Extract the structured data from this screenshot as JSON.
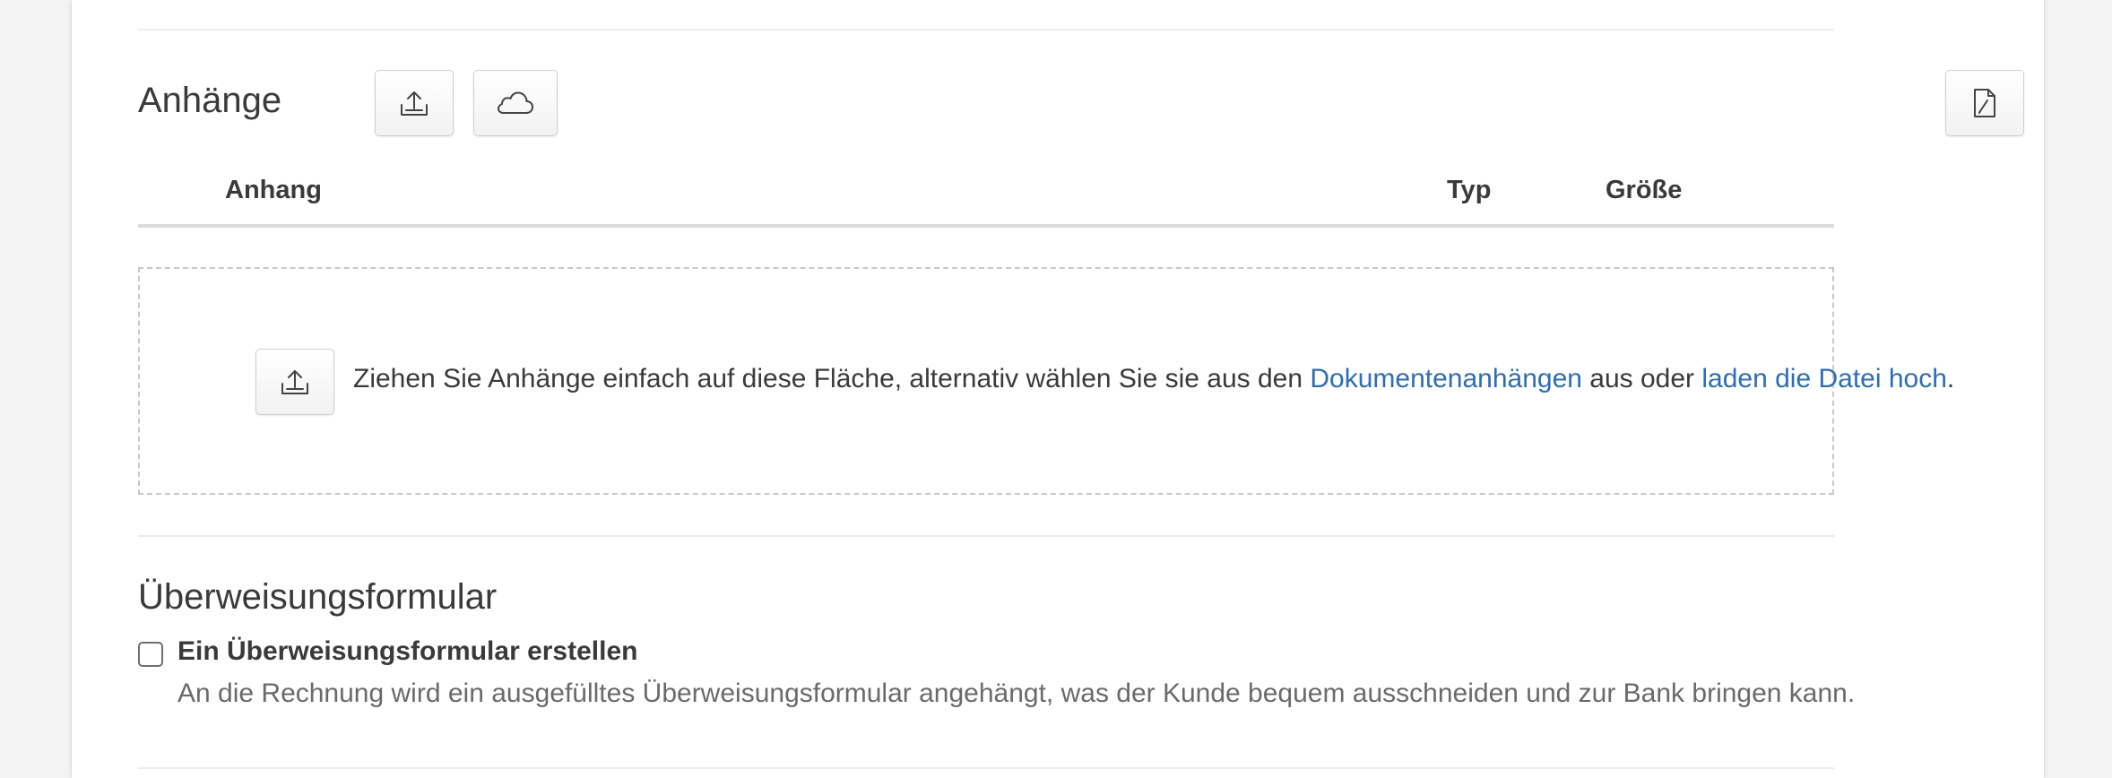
{
  "attachments": {
    "title": "Anhänge",
    "upload_button_icon": "upload-icon",
    "cloud_button_icon": "cloud-icon",
    "document_button_icon": "document-edit-icon",
    "table": {
      "columns": [
        "Anhang",
        "Typ",
        "Größe"
      ]
    },
    "dropzone": {
      "icon": "upload-icon",
      "text_before": "Ziehen Sie Anhänge einfach auf diese Fläche, alternativ wählen Sie sie aus den ",
      "link_documents": "Dokumentenanhängen",
      "text_middle": " aus oder ",
      "link_upload": "laden die Datei hoch",
      "text_after": "."
    }
  },
  "transfer_form": {
    "title": "Überweisungsformular",
    "checkbox_label": "Ein Überweisungsformular erstellen",
    "checkbox_checked": false,
    "help_text": "An die Rechnung wird ein ausgefülltes Überweisungsformular angehängt, was der Kunde bequem ausschneiden und zur Bank bringen kann."
  },
  "colors": {
    "link": "#2f6db5",
    "text": "#3a3a3a",
    "muted_text": "#6a6a6a",
    "background": "#f3f3f3",
    "panel": "#ffffff"
  }
}
